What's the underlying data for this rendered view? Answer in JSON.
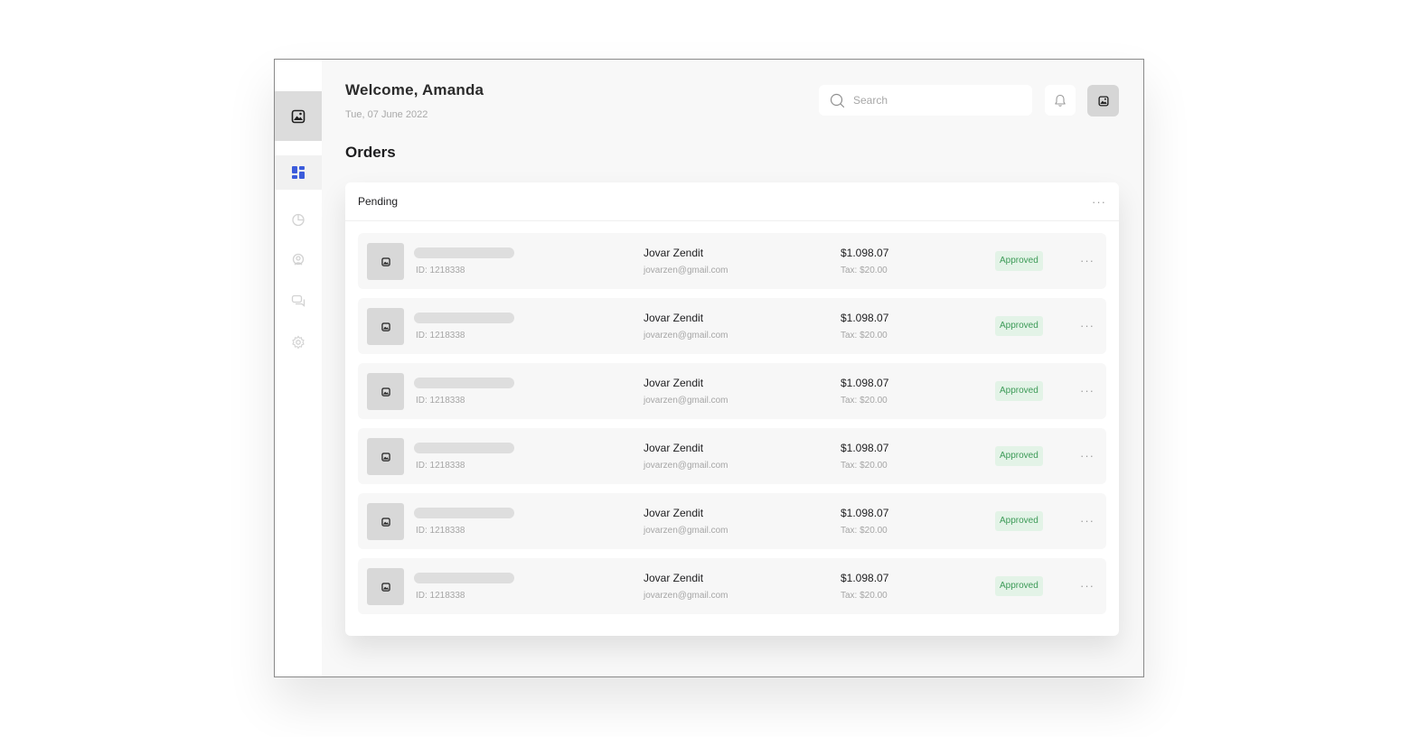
{
  "header": {
    "welcome": "Welcome, Amanda",
    "date": "Tue, 07 June 2022",
    "search_placeholder": "Search"
  },
  "page_title": "Orders",
  "card": {
    "title": "Pending"
  },
  "sidebar": {
    "items": [
      {
        "icon": "dashboard-icon",
        "active": true
      },
      {
        "icon": "pie-chart-icon",
        "active": false
      },
      {
        "icon": "user-icon",
        "active": false
      },
      {
        "icon": "chat-icon",
        "active": false
      },
      {
        "icon": "settings-icon",
        "active": false
      }
    ]
  },
  "orders": [
    {
      "id": "ID: 1218338",
      "name": "Jovar Zendit",
      "email": "jovarzen@gmail.com",
      "price": "$1.098.07",
      "tax": "Tax: $20.00",
      "status": "Approved"
    },
    {
      "id": "ID: 1218338",
      "name": "Jovar Zendit",
      "email": "jovarzen@gmail.com",
      "price": "$1.098.07",
      "tax": "Tax: $20.00",
      "status": "Approved"
    },
    {
      "id": "ID: 1218338",
      "name": "Jovar Zendit",
      "email": "jovarzen@gmail.com",
      "price": "$1.098.07",
      "tax": "Tax: $20.00",
      "status": "Approved"
    },
    {
      "id": "ID: 1218338",
      "name": "Jovar Zendit",
      "email": "jovarzen@gmail.com",
      "price": "$1.098.07",
      "tax": "Tax: $20.00",
      "status": "Approved"
    },
    {
      "id": "ID: 1218338",
      "name": "Jovar Zendit",
      "email": "jovarzen@gmail.com",
      "price": "$1.098.07",
      "tax": "Tax: $20.00",
      "status": "Approved"
    },
    {
      "id": "ID: 1218338",
      "name": "Jovar Zendit",
      "email": "jovarzen@gmail.com",
      "price": "$1.098.07",
      "tax": "Tax: $20.00",
      "status": "Approved"
    }
  ],
  "colors": {
    "accent": "#3b5bdb",
    "approved_bg": "#e3f3e7",
    "approved_text": "#3c9a57"
  }
}
